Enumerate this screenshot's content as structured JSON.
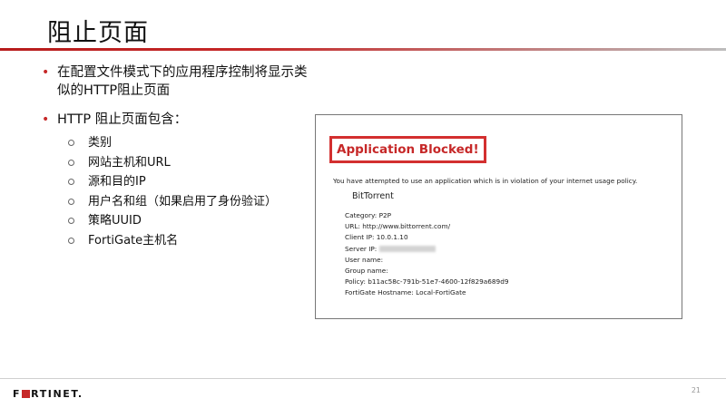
{
  "slide": {
    "title": "阻止页面",
    "page_number": "21"
  },
  "bullets": [
    {
      "text": "在配置文件模式下的应用程序控制将显示类似的HTTP阻止页面"
    },
    {
      "text": "HTTP 阻止页面包含："
    }
  ],
  "sub_bullets": [
    "类别",
    "网站主机和URL",
    "源和目的IP",
    "用户名和组（如果启用了身份验证）",
    "策略UUID",
    "FortiGate主机名"
  ],
  "block_page": {
    "heading": "Application Blocked!",
    "message": "You have attempted to use an application which is in violation of your internet usage policy.",
    "app_name": "BitTorrent",
    "category": "Category: P2P",
    "url": "URL: http://www.bittorrent.com/",
    "client_ip": "Client IP: 10.0.1.10",
    "server_ip_label": "Server IP:",
    "user_name": "User name:",
    "group_name": "Group name:",
    "policy": "Policy: b11ac58c-791b-51e7-4600-12f829a689d9",
    "fortigate_hostname": "FortiGate Hostname: Local-FortiGate"
  },
  "footer": {
    "logo_text_left": "F",
    "logo_text_right": "RTINET."
  },
  "colors": {
    "accent_red": "#c62828",
    "block_border": "#d32f2f"
  }
}
